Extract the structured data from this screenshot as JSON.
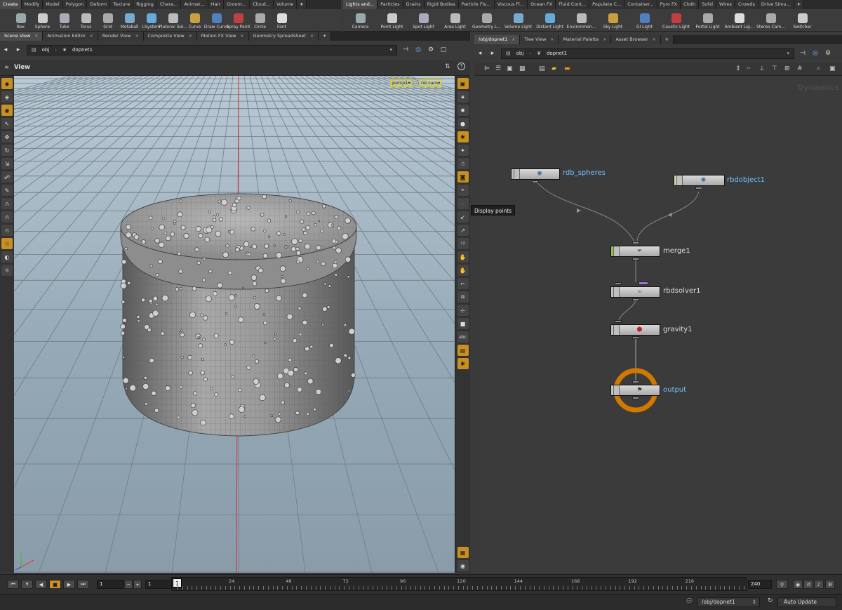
{
  "shelf_left": {
    "tabs": [
      "Create",
      "Modify",
      "Model",
      "Polygon",
      "Deform",
      "Texture",
      "Rigging",
      "Chara...",
      "Animat...",
      "Hair",
      "Groom...",
      "Cloud...",
      "Volume"
    ],
    "plus": "+",
    "tools": [
      {
        "label": "Box",
        "icon": "box-icon"
      },
      {
        "label": "Sphere",
        "icon": "sphere-icon"
      },
      {
        "label": "Tube",
        "icon": "tube-icon"
      },
      {
        "label": "Torus",
        "icon": "torus-icon"
      },
      {
        "label": "Grid",
        "icon": "grid-icon"
      },
      {
        "label": "Metaball",
        "icon": "metaball-icon"
      },
      {
        "label": "LSystem",
        "icon": "lsystem-icon"
      },
      {
        "label": "Platonic Sol...",
        "icon": "platonic-icon"
      },
      {
        "label": "Curve",
        "icon": "curve-icon"
      },
      {
        "label": "Draw Curve",
        "icon": "draw-curve-icon"
      },
      {
        "label": "Spray Paint",
        "icon": "spray-paint-icon"
      },
      {
        "label": "Circle",
        "icon": "circle-icon"
      },
      {
        "label": "Font",
        "icon": "font-icon"
      }
    ]
  },
  "shelf_right": {
    "tabs": [
      "Lights and...",
      "Particles",
      "Grains",
      "Rigid Bodies",
      "Particle Flu...",
      "Viscous Fl...",
      "Ocean FX",
      "Fluid Cont...",
      "Populate C...",
      "Container...",
      "Pyro FX",
      "Cloth",
      "Solid",
      "Wires",
      "Crowds",
      "Drive Simu..."
    ],
    "plus": "+",
    "tools": [
      {
        "label": "Camera",
        "icon": "camera-icon"
      },
      {
        "label": "Point Light",
        "icon": "point-light-icon"
      },
      {
        "label": "Spot Light",
        "icon": "spot-light-icon"
      },
      {
        "label": "Area Light",
        "icon": "area-light-icon"
      },
      {
        "label": "Geometry L...",
        "icon": "geometry-light-icon"
      },
      {
        "label": "Volume Light",
        "icon": "volume-light-icon"
      },
      {
        "label": "Distant Light",
        "icon": "distant-light-icon"
      },
      {
        "label": "Environmen...",
        "icon": "environment-light-icon"
      },
      {
        "label": "Sky Light",
        "icon": "sky-light-icon"
      },
      {
        "label": "GI Light",
        "icon": "gi-light-icon"
      },
      {
        "label": "Caustic Light",
        "icon": "caustic-light-icon"
      },
      {
        "label": "Portal Light",
        "icon": "portal-light-icon"
      },
      {
        "label": "Ambient Lig...",
        "icon": "ambient-light-icon"
      },
      {
        "label": "Stereo Cam...",
        "icon": "stereo-camera-icon"
      },
      {
        "label": "Switcher",
        "icon": "switcher-icon"
      }
    ]
  },
  "left_pane": {
    "tabs": [
      "Scene View",
      "Animation Editor",
      "Render View",
      "Composite View",
      "Motion FX View",
      "Geometry Spreadsheet"
    ],
    "path": {
      "root": "obj",
      "node": "dopnet1"
    },
    "view_title": "View",
    "camera_menu": "persp1",
    "cam_menu": "no cam"
  },
  "right_pane": {
    "tabs": [
      "/obj/dopnet1",
      "Tree View",
      "Material Palette",
      "Asset Browser"
    ],
    "path": {
      "root": "obj",
      "node": "dopnet1"
    },
    "context_label": "Dynamics",
    "tooltip": "Display points",
    "nodes": [
      {
        "name": "rdb_spheres"
      },
      {
        "name": "rbdobject1"
      },
      {
        "name": "merge1"
      },
      {
        "name": "rbdsolver1"
      },
      {
        "name": "gravity1"
      },
      {
        "name": "output"
      }
    ]
  },
  "timeline": {
    "current_frame": "1",
    "start_frame": "1",
    "end_frame": "240",
    "playhead_label": "1",
    "ticks": [
      "24",
      "48",
      "72",
      "96",
      "120",
      "144",
      "168",
      "192",
      "216"
    ]
  },
  "status": {
    "path": "/obj/dopnet1",
    "update_mode": "Auto Update"
  },
  "colors": {
    "accent": "#c89020",
    "node_label_blue": "#6fc2ff",
    "output_ring": "#d07800"
  }
}
